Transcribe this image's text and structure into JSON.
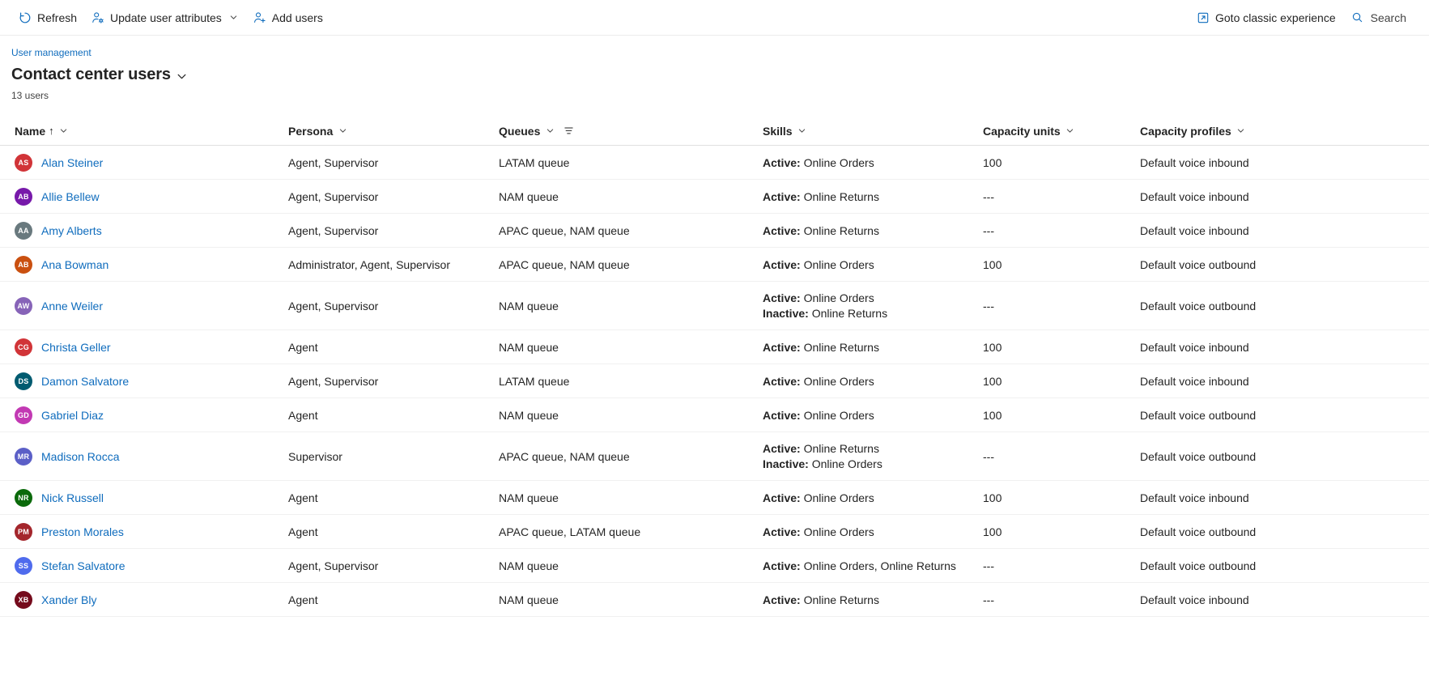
{
  "commandbar": {
    "refresh_label": "Refresh",
    "update_attributes_label": "Update user attributes",
    "add_users_label": "Add users",
    "goto_classic_label": "Goto classic experience",
    "search_label": "Search"
  },
  "header": {
    "breadcrumb": "User management",
    "title": "Contact center users",
    "count": "13 users"
  },
  "columns": [
    {
      "key": "name",
      "label": "Name",
      "sort": "↑"
    },
    {
      "key": "persona",
      "label": "Persona"
    },
    {
      "key": "queues",
      "label": "Queues"
    },
    {
      "key": "skills",
      "label": "Skills"
    },
    {
      "key": "units",
      "label": "Capacity units"
    },
    {
      "key": "profiles",
      "label": "Capacity profiles"
    }
  ],
  "colors": {
    "link": "#0f6cbd",
    "text": "#242424",
    "border": "#f0f0f0",
    "header_border": "#e0e0e0"
  },
  "rows": [
    {
      "initials": "AS",
      "avatar_color": "#d13438",
      "name": "Alan Steiner",
      "persona": "Agent, Supervisor",
      "queues": "LATAM queue",
      "skills": [
        {
          "state": "Active:",
          "value": "Online Orders"
        }
      ],
      "units": "100",
      "profiles": "Default voice inbound"
    },
    {
      "initials": "AB",
      "avatar_color": "#7719aa",
      "name": "Allie Bellew",
      "persona": "Agent, Supervisor",
      "queues": "NAM queue",
      "skills": [
        {
          "state": "Active:",
          "value": "Online Returns"
        }
      ],
      "units": "---",
      "profiles": "Default voice inbound"
    },
    {
      "initials": "AA",
      "avatar_color": "#69797e",
      "name": "Amy Alberts",
      "persona": "Agent, Supervisor",
      "queues": "APAC queue, NAM queue",
      "skills": [
        {
          "state": "Active:",
          "value": "Online Returns"
        }
      ],
      "units": "---",
      "profiles": "Default voice inbound"
    },
    {
      "initials": "AB",
      "avatar_color": "#ca5010",
      "name": "Ana Bowman",
      "persona": "Administrator, Agent, Supervisor",
      "queues": "APAC queue, NAM queue",
      "skills": [
        {
          "state": "Active:",
          "value": "Online Orders"
        }
      ],
      "units": "100",
      "profiles": "Default voice outbound"
    },
    {
      "initials": "AW",
      "avatar_color": "#8764b8",
      "name": "Anne Weiler",
      "persona": "Agent, Supervisor",
      "queues": "NAM queue",
      "skills": [
        {
          "state": "Active:",
          "value": "Online Orders"
        },
        {
          "state": "Inactive:",
          "value": "Online Returns"
        }
      ],
      "units": "---",
      "profiles": "Default voice outbound",
      "tall": true
    },
    {
      "initials": "CG",
      "avatar_color": "#d13438",
      "name": "Christa Geller",
      "persona": "Agent",
      "queues": "NAM queue",
      "skills": [
        {
          "state": "Active:",
          "value": "Online Returns"
        }
      ],
      "units": "100",
      "profiles": "Default voice inbound"
    },
    {
      "initials": "DS",
      "avatar_color": "#005b70",
      "name": "Damon Salvatore",
      "persona": "Agent, Supervisor",
      "queues": "LATAM queue",
      "skills": [
        {
          "state": "Active:",
          "value": "Online Orders"
        }
      ],
      "units": "100",
      "profiles": "Default voice inbound"
    },
    {
      "initials": "GD",
      "avatar_color": "#c239b3",
      "name": "Gabriel Diaz",
      "persona": "Agent",
      "queues": "NAM queue",
      "skills": [
        {
          "state": "Active:",
          "value": "Online Orders"
        }
      ],
      "units": "100",
      "profiles": "Default voice outbound"
    },
    {
      "initials": "MR",
      "avatar_color": "#5b5fc7",
      "name": "Madison Rocca",
      "persona": "Supervisor",
      "queues": "APAC queue, NAM queue",
      "skills": [
        {
          "state": "Active:",
          "value": "Online Returns"
        },
        {
          "state": "Inactive:",
          "value": "Online Orders"
        }
      ],
      "units": "---",
      "profiles": "Default voice outbound",
      "tall": true
    },
    {
      "initials": "NR",
      "avatar_color": "#0b6a0b",
      "name": "Nick Russell",
      "persona": "Agent",
      "queues": "NAM queue",
      "skills": [
        {
          "state": "Active:",
          "value": "Online Orders"
        }
      ],
      "units": "100",
      "profiles": "Default voice inbound"
    },
    {
      "initials": "PM",
      "avatar_color": "#a4262c",
      "name": "Preston Morales",
      "persona": "Agent",
      "queues": "APAC queue, LATAM queue",
      "skills": [
        {
          "state": "Active:",
          "value": "Online Orders"
        }
      ],
      "units": "100",
      "profiles": "Default voice outbound"
    },
    {
      "initials": "SS",
      "avatar_color": "#4f6bed",
      "name": "Stefan Salvatore",
      "persona": "Agent, Supervisor",
      "queues": "NAM queue",
      "skills": [
        {
          "state": "Active:",
          "value": "Online Orders, Online Returns"
        }
      ],
      "units": "---",
      "profiles": "Default voice outbound"
    },
    {
      "initials": "XB",
      "avatar_color": "#750b1c",
      "name": "Xander Bly",
      "persona": "Agent",
      "queues": "NAM queue",
      "skills": [
        {
          "state": "Active:",
          "value": "Online Returns"
        }
      ],
      "units": "---",
      "profiles": "Default voice inbound"
    }
  ]
}
